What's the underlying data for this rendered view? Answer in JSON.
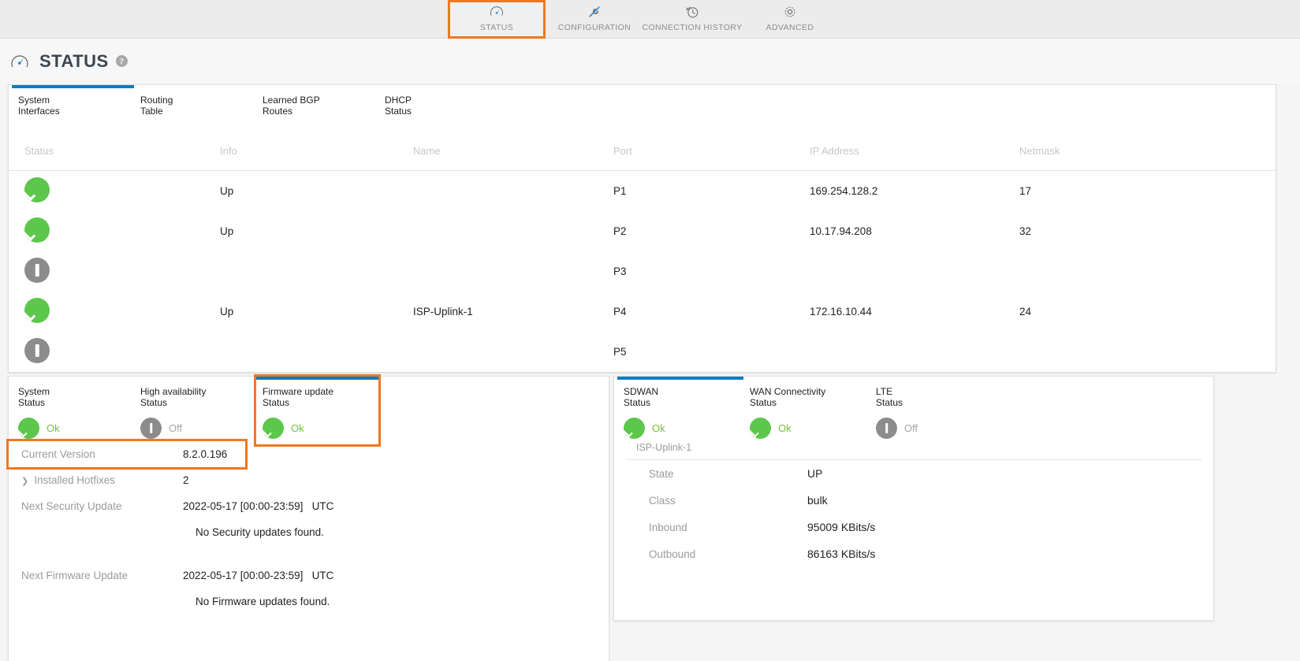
{
  "nav": {
    "items": [
      {
        "label": "STATUS",
        "icon": "gauge-icon",
        "active": true,
        "highlighted": true
      },
      {
        "label": "CONFIGURATION",
        "icon": "wrench-screwdriver-icon",
        "active": false,
        "highlighted": false
      },
      {
        "label": "CONNECTION HISTORY",
        "icon": "clock-history-icon",
        "active": false,
        "highlighted": false
      },
      {
        "label": "ADVANCED",
        "icon": "gear-icon",
        "active": false,
        "highlighted": false
      }
    ]
  },
  "page": {
    "title": "STATUS",
    "title_icon": "gauge-icon",
    "help_icon": "question-mark-icon",
    "help_glyph": "?"
  },
  "colors": {
    "accent_blue": "#0c7cc0",
    "highlight_orange": "#f07820",
    "status_ok_green": "#5cc74b",
    "status_off_grey": "#8c8c8c"
  },
  "interfaces_card": {
    "tabs": [
      {
        "line1": "System",
        "line2": "Interfaces",
        "active": true
      },
      {
        "line1": "Routing",
        "line2": "Table",
        "active": false
      },
      {
        "line1": "Learned BGP",
        "line2": "Routes",
        "active": false
      },
      {
        "line1": "DHCP",
        "line2": "Status",
        "active": false
      }
    ],
    "columns": [
      "Status",
      "Info",
      "Name",
      "Port",
      "IP Address",
      "Netmask"
    ],
    "rows": [
      {
        "status": "ok",
        "info": "Up",
        "name": "",
        "port": "P1",
        "ip": "169.254.128.2",
        "netmask": "17"
      },
      {
        "status": "ok",
        "info": "Up",
        "name": "",
        "port": "P2",
        "ip": "10.17.94.208",
        "netmask": "32"
      },
      {
        "status": "off",
        "info": "",
        "name": "",
        "port": "P3",
        "ip": "",
        "netmask": ""
      },
      {
        "status": "ok",
        "info": "Up",
        "name": "ISP-Uplink-1",
        "port": "P4",
        "ip": "172.16.10.44",
        "netmask": "24"
      },
      {
        "status": "off",
        "info": "",
        "name": "",
        "port": "P5",
        "ip": "",
        "netmask": ""
      }
    ]
  },
  "system_card": {
    "tabs": [
      {
        "line1": "System",
        "line2": "Status",
        "status": "ok",
        "status_label": "Ok",
        "active": false,
        "highlighted": false
      },
      {
        "line1": "High availability",
        "line2": "Status",
        "status": "off",
        "status_label": "Off",
        "active": false,
        "highlighted": false
      },
      {
        "line1": "Firmware update",
        "line2": "Status",
        "status": "ok",
        "status_label": "Ok",
        "active": true,
        "highlighted": true
      }
    ],
    "rows": [
      {
        "label": "Current Version",
        "value": "8.2.0.196",
        "caret": false,
        "highlighted": true
      },
      {
        "label": "Installed Hotfixes",
        "value": "2",
        "caret": true,
        "highlighted": false
      },
      {
        "label": "Next Security Update",
        "value": "2022-05-17 [00:00-23:59]   UTC",
        "caret": false,
        "highlighted": false
      },
      {
        "label": "",
        "value": "No Security updates found.",
        "caret": false,
        "highlighted": false
      },
      {
        "label": "Next Firmware Update",
        "value": "2022-05-17 [00:00-23:59]   UTC",
        "caret": false,
        "highlighted": false
      },
      {
        "label": "",
        "value": "No Firmware updates found.",
        "caret": false,
        "highlighted": false
      }
    ]
  },
  "sdwan_card": {
    "tabs": [
      {
        "line1": "SDWAN",
        "line2": "Status",
        "status": "ok",
        "status_label": "Ok",
        "active": true
      },
      {
        "line1": "WAN Connectivity",
        "line2": "Status",
        "status": "ok",
        "status_label": "Ok",
        "active": false
      },
      {
        "line1": "LTE",
        "line2": "Status",
        "status": "off",
        "status_label": "Off",
        "active": false
      }
    ],
    "group_title": "ISP-Uplink-1",
    "rows": [
      {
        "label": "State",
        "value": "UP"
      },
      {
        "label": "Class",
        "value": "bulk"
      },
      {
        "label": "Inbound",
        "value": "95009 KBits/s"
      },
      {
        "label": "Outbound",
        "value": "86163 KBits/s"
      }
    ]
  }
}
